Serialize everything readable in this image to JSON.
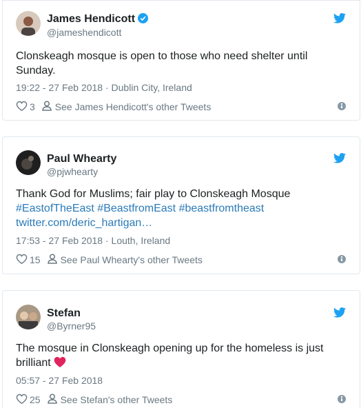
{
  "tweets": [
    {
      "name": "James Hendicott",
      "handle": "@jameshendicott",
      "verified": true,
      "text": "Clonskeagh mosque is open to those who need shelter until Sunday.",
      "meta": "19:22 - 27 Feb 2018 · Dublin City, Ireland",
      "likes": "3",
      "other_tweets": "See James Hendicott's other Tweets"
    },
    {
      "name": "Paul Whearty",
      "handle": "@pjwhearty",
      "verified": false,
      "text_plain": "Thank God for Muslims; fair play to Clonskeagh Mosque",
      "hashtags": [
        "#EastofTheEast",
        "#BeastfromEast",
        "#beastfromtheast"
      ],
      "link": "twitter.com/deric_hartigan…",
      "meta": "17:53 - 27 Feb 2018 · Louth, Ireland",
      "likes": "15",
      "other_tweets": "See Paul Whearty's other Tweets"
    },
    {
      "name": "Stefan",
      "handle": "@Byrner95",
      "verified": false,
      "text": "The mosque in Clonskeagh opening up for the homeless is just brilliant",
      "emoji": "red-heart-icon",
      "meta": "05:57 - 27 Feb 2018",
      "likes": "25",
      "other_tweets": "See Stefan's other Tweets"
    }
  ],
  "colors": {
    "twitter_blue": "#1da1f2",
    "link_blue": "#2b7bb9",
    "meta_gray": "#697882",
    "heart_red": "#e0245e"
  }
}
